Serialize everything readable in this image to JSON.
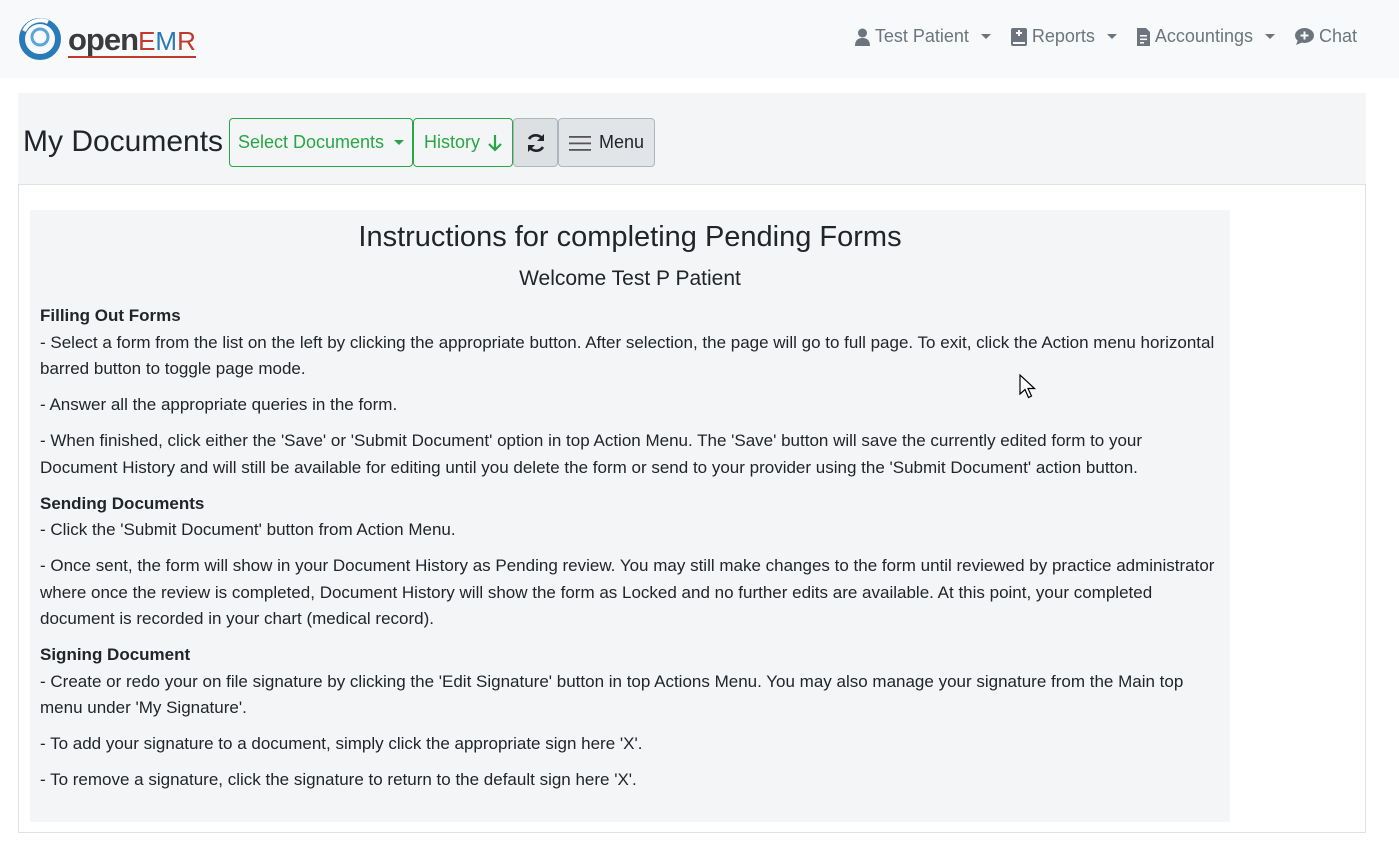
{
  "brand": {
    "open": "open",
    "emr_e": "E",
    "emr_m": "M",
    "emr_r": "R"
  },
  "nav": {
    "items": [
      {
        "label": "Test Patient",
        "icon": "user-icon",
        "dropdown": true
      },
      {
        "label": "Reports",
        "icon": "book-icon",
        "dropdown": true
      },
      {
        "label": "Accountings",
        "icon": "file-invoice-icon",
        "dropdown": true
      },
      {
        "label": "Chat",
        "icon": "chat-icon",
        "dropdown": false
      }
    ]
  },
  "toolbar": {
    "title": "My Documents",
    "select_label": "Select Documents",
    "history_label": "History",
    "menu_label": "Menu"
  },
  "instructions": {
    "title": "Instructions for completing Pending Forms",
    "welcome": "Welcome Test P Patient",
    "sections": [
      {
        "heading": "Filling Out Forms",
        "paragraphs": [
          "- Select a form from the list on the left by clicking the appropriate button. After selection, the page will go to full page. To exit, click the Action menu horizontal barred button to toggle page mode.",
          "- Answer all the appropriate queries in the form.",
          "- When finished, click either the 'Save' or 'Submit Document' option in top Action Menu. The 'Save' button will save the currently edited form to your Document History and will still be available for editing until you delete the form or send to your provider using the 'Submit Document' action button."
        ]
      },
      {
        "heading": "Sending Documents",
        "paragraphs": [
          "- Click the 'Submit Document' button from Action Menu.",
          "- Once sent, the form will show in your Document History as Pending review. You may still make changes to the form until reviewed by practice administrator where once the review is completed, Document History will show the form as Locked and no further edits are available. At this point, your completed document is recorded in your chart (medical record)."
        ]
      },
      {
        "heading": "Signing Document",
        "paragraphs": [
          "- Create or redo your on file signature by clicking the 'Edit Signature' button in top Actions Menu. You may also manage your signature from the Main top menu under 'My Signature'.",
          "- To add your signature to a document, simply click the appropriate sign here 'X'.",
          "- To remove a signature, click the signature to return to the default sign here 'X'."
        ]
      }
    ]
  },
  "colors": {
    "accent_green": "#28a745",
    "brand_red": "#c0392b",
    "brand_blue": "#2a7ab8",
    "nav_text": "#6c757d"
  }
}
